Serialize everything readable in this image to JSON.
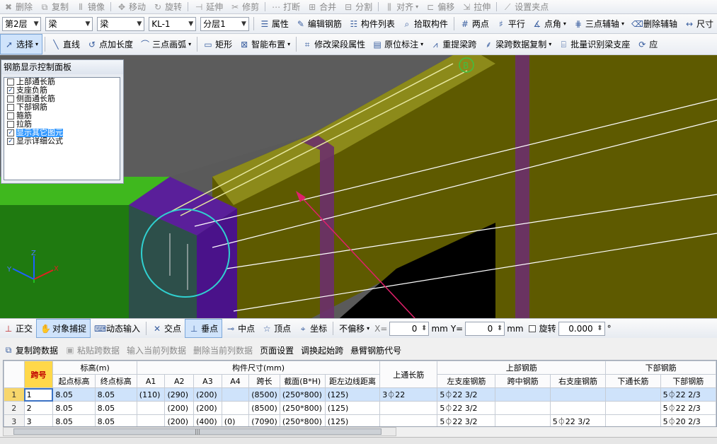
{
  "toolbar1": [
    "删除",
    "复制",
    "镜像",
    "移动",
    "旋转",
    "延伸",
    "修剪",
    "打断",
    "合并",
    "分割",
    "对齐",
    "偏移",
    "拉伸",
    "设置夹点"
  ],
  "toolbar2": {
    "floor": "第2层",
    "category": "梁",
    "type": "梁",
    "component": "KL-1",
    "layer": "分层1",
    "buttons": [
      "属性",
      "编辑钢筋",
      "构件列表",
      "拾取构件",
      "两点",
      "平行",
      "点角",
      "三点辅轴",
      "删除辅轴",
      "尺寸"
    ]
  },
  "toolbar3": {
    "select": "选择",
    "buttons": [
      "直线",
      "点加长度",
      "三点画弧",
      "矩形",
      "智能布置",
      "修改梁段属性",
      "原位标注",
      "重提梁跨",
      "梁跨数据复制",
      "批量识别梁支座",
      "应"
    ]
  },
  "rebar_panel": {
    "title": "钢筋显示控制面板",
    "items": [
      {
        "label": "上部通长筋",
        "checked": false
      },
      {
        "label": "支座负筋",
        "checked": true
      },
      {
        "label": "侧面通长筋",
        "checked": false
      },
      {
        "label": "下部钢筋",
        "checked": false
      },
      {
        "label": "箍筋",
        "checked": false
      },
      {
        "label": "拉筋",
        "checked": false
      },
      {
        "label": "显示其它图元",
        "checked": true
      },
      {
        "label": "显示详细公式",
        "checked": true
      }
    ]
  },
  "viewport": {
    "axis_label": "B",
    "axes": [
      "X",
      "Y",
      "Z"
    ]
  },
  "snapbar": {
    "buttons": [
      "正交",
      "对象捕捉",
      "动态输入",
      "交点",
      "垂点",
      "中点",
      "顶点",
      "坐标"
    ],
    "offset": "不偏移",
    "x_label": "X=",
    "x_value": "0",
    "y_label": "Y=",
    "y_value": "0",
    "unit": "mm",
    "rotate_label": "旋转",
    "rotate_value": "0.000",
    "degree": "°"
  },
  "grid_tools": [
    "复制跨数据",
    "粘贴跨数据",
    "输入当前列数据",
    "删除当前列数据",
    "页面设置",
    "调换起始跨",
    "悬臂钢筋代号"
  ],
  "table": {
    "group_headers": [
      "跨号",
      "标高(m)",
      "构件尺寸(mm)",
      "上通长筋",
      "上部钢筋",
      "下部钢筋"
    ],
    "sub_headers": [
      "起点标高",
      "终点标高",
      "A1",
      "A2",
      "A3",
      "A4",
      "跨长",
      "截面(B*H)",
      "距左边线距离",
      "左支座钢筋",
      "跨中钢筋",
      "右支座钢筋",
      "下通长筋",
      "下部钢筋"
    ],
    "rows": [
      {
        "n": "1",
        "span": "1",
        "start": "8.05",
        "end": "8.05",
        "a1": "(110)",
        "a2": "(290)",
        "a3": "(200)",
        "a4": "",
        "len": "(8500)",
        "sec": "(250*800)",
        "dist": "(125)",
        "top": "3⏀22",
        "left": "5⏀22 3/2",
        "mid": "",
        "right": "",
        "btm": "",
        "bottom": "5⏀22 2/3"
      },
      {
        "n": "2",
        "span": "2",
        "start": "8.05",
        "end": "8.05",
        "a1": "",
        "a2": "(200)",
        "a3": "(200)",
        "a4": "",
        "len": "(8500)",
        "sec": "(250*800)",
        "dist": "(125)",
        "top": "",
        "left": "5⏀22 3/2",
        "mid": "",
        "right": "",
        "btm": "",
        "bottom": "5⏀22 2/3"
      },
      {
        "n": "3",
        "span": "3",
        "start": "8.05",
        "end": "8.05",
        "a1": "",
        "a2": "(200)",
        "a3": "(400)",
        "a4": "(0)",
        "len": "(7090)",
        "sec": "(250*800)",
        "dist": "(125)",
        "top": "",
        "left": "5⏀22 3/2",
        "mid": "",
        "right": "5⏀22 3/2",
        "btm": "",
        "bottom": "5⏀20 2/3"
      }
    ]
  }
}
